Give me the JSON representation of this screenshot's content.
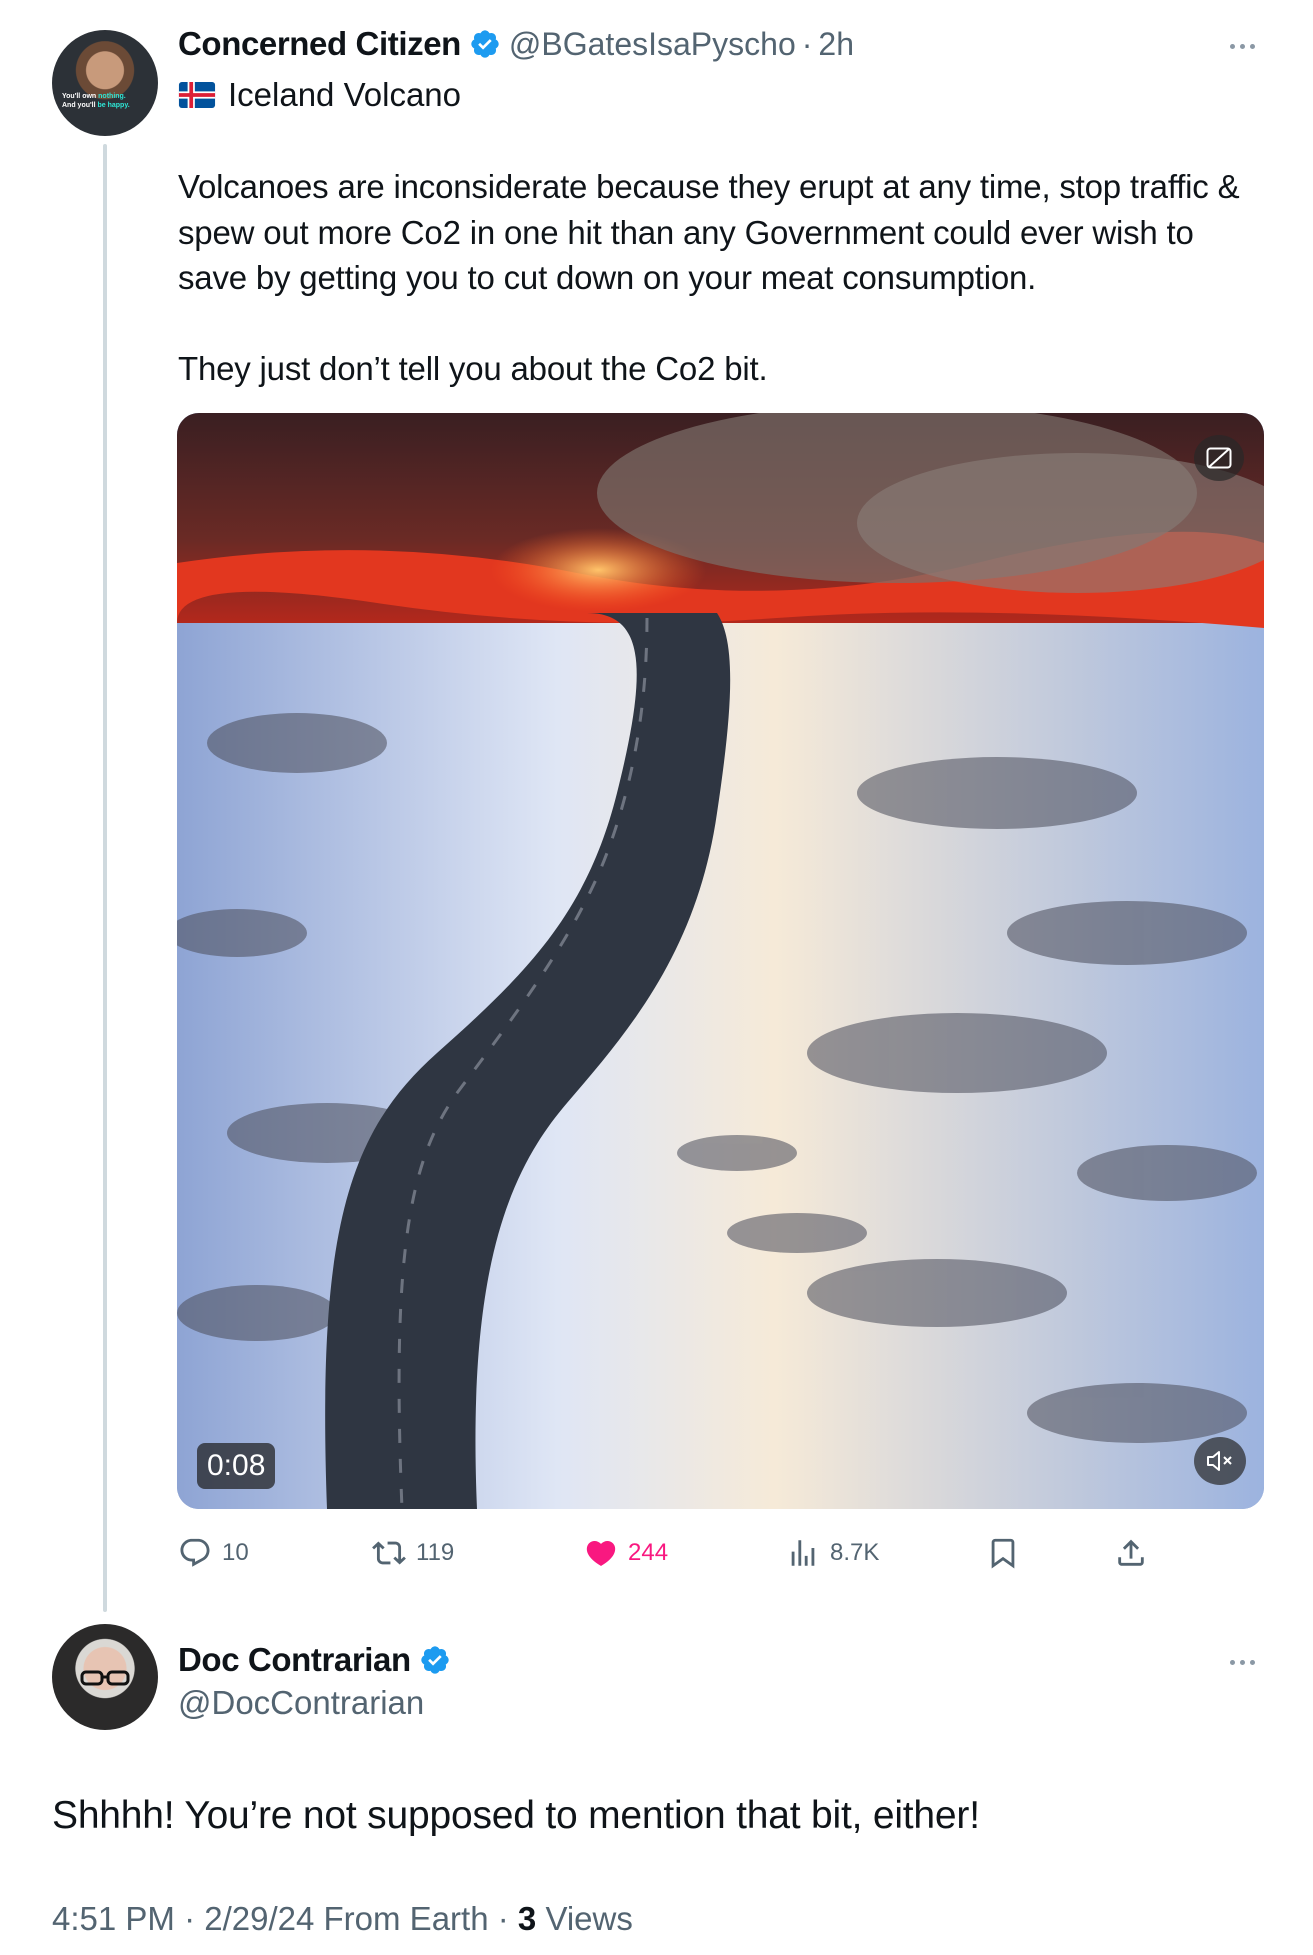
{
  "parent_tweet": {
    "display_name": "Concerned Citizen",
    "handle": "@BGatesIsaPyscho",
    "separator": "·",
    "time": "2h",
    "topic": "Iceland Volcano",
    "avatar_caption_line1_a": "You'll own ",
    "avatar_caption_line1_b": "nothing.",
    "avatar_caption_line2_a": "And you'll ",
    "avatar_caption_line2_b": "be happy.",
    "text_paragraph_1": "Volcanoes are inconsiderate because they erupt at any time, stop traffic & spew out more Co2 in one hit than any Government could ever wish to save by getting you to cut down on your meat consumption.",
    "text_paragraph_2": "They just don’t tell you about the Co2 bit.",
    "video_duration": "0:08",
    "stats": {
      "replies": "10",
      "reposts": "119",
      "likes": "244",
      "views": "8.7K"
    }
  },
  "reply_tweet": {
    "display_name": "Doc Contrarian",
    "handle": "@DocContrarian",
    "text": "Shhhh! You’re not supposed to mention that bit, either!",
    "meta_time": "4:51 PM",
    "meta_sep": "·",
    "meta_date": "2/29/24 From Earth",
    "meta_views_count": "3",
    "meta_views_label": "Views"
  },
  "colors": {
    "verified_blue": "#1d9bf0",
    "like_pink": "#f91880",
    "secondary_text": "#536471"
  },
  "icons": [
    "verified-badge-icon",
    "more-icon",
    "iceland-flag-icon",
    "captions-icon",
    "muted-speaker-icon",
    "reply-icon",
    "repost-icon",
    "heart-icon",
    "views-icon",
    "bookmark-icon",
    "share-icon"
  ]
}
